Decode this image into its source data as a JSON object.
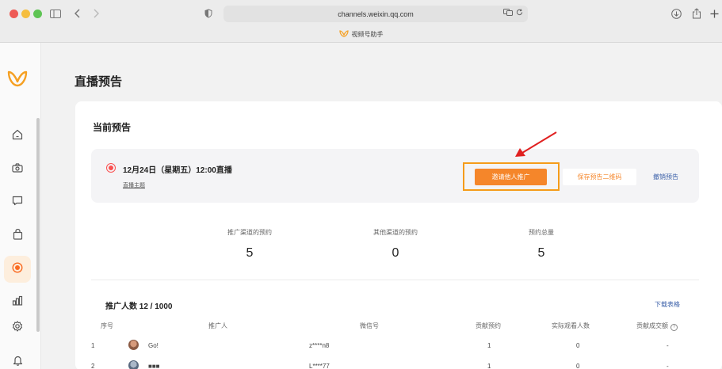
{
  "browser": {
    "url": "channels.weixin.qq.com",
    "tab_title": "视频号助手"
  },
  "sidebar": {
    "items": [
      {
        "name": "home-icon"
      },
      {
        "name": "camera-icon"
      },
      {
        "name": "message-icon"
      },
      {
        "name": "bag-icon"
      },
      {
        "name": "live-icon",
        "active": true
      },
      {
        "name": "chart-icon"
      },
      {
        "name": "settings-icon"
      },
      {
        "name": "bell-icon"
      }
    ]
  },
  "page": {
    "title": "直播预告"
  },
  "current": {
    "title": "当前预告",
    "time": "12月24日（星期五）12:00直播",
    "sub": "直播主题",
    "invite_button": "邀请他人推广",
    "save_qr_button": "保存预告二维码",
    "cancel_link": "撤销预告"
  },
  "stats": [
    {
      "label": "推广渠道的预约",
      "value": "5"
    },
    {
      "label": "其他渠道的预约",
      "value": "0"
    },
    {
      "label": "预约总量",
      "value": "5"
    }
  ],
  "promoters": {
    "heading": "推广人数 12 / 1000",
    "download": "下载表格",
    "columns": [
      "序号",
      "推广人",
      "微信号",
      "贡献预约",
      "实际观看人数",
      "贡献成交额"
    ],
    "rows": [
      {
        "index": "1",
        "name": "Go!",
        "wechat": "z****n8",
        "reservations": "1",
        "viewers": "0",
        "sales": "-"
      },
      {
        "index": "2",
        "name": "■■■",
        "wechat": "L****77",
        "reservations": "1",
        "viewers": "0",
        "sales": "-"
      }
    ]
  },
  "colors": {
    "accent": "#f5862a",
    "highlight_frame": "#f59c1a",
    "arrow": "#e02020",
    "link": "#3a5fa8"
  }
}
